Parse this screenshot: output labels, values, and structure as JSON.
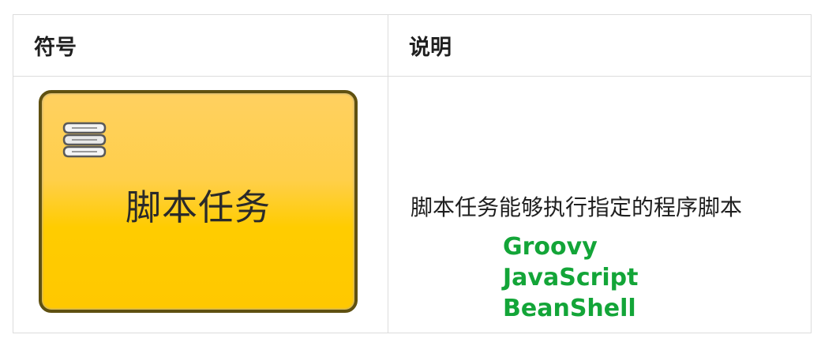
{
  "table": {
    "headers": {
      "symbol": "符号",
      "description": "说明"
    },
    "row": {
      "symbol": {
        "task_label": "脚本任务",
        "icon": "script-icon",
        "box_fill_color": "#ffcc00",
        "box_border_color": "#5f5010"
      },
      "description": {
        "text": "脚本任务能够执行指定的程序脚本",
        "languages": [
          "Groovy",
          "JavaScript",
          "BeanShell"
        ],
        "languages_color": "#13a538"
      }
    }
  }
}
